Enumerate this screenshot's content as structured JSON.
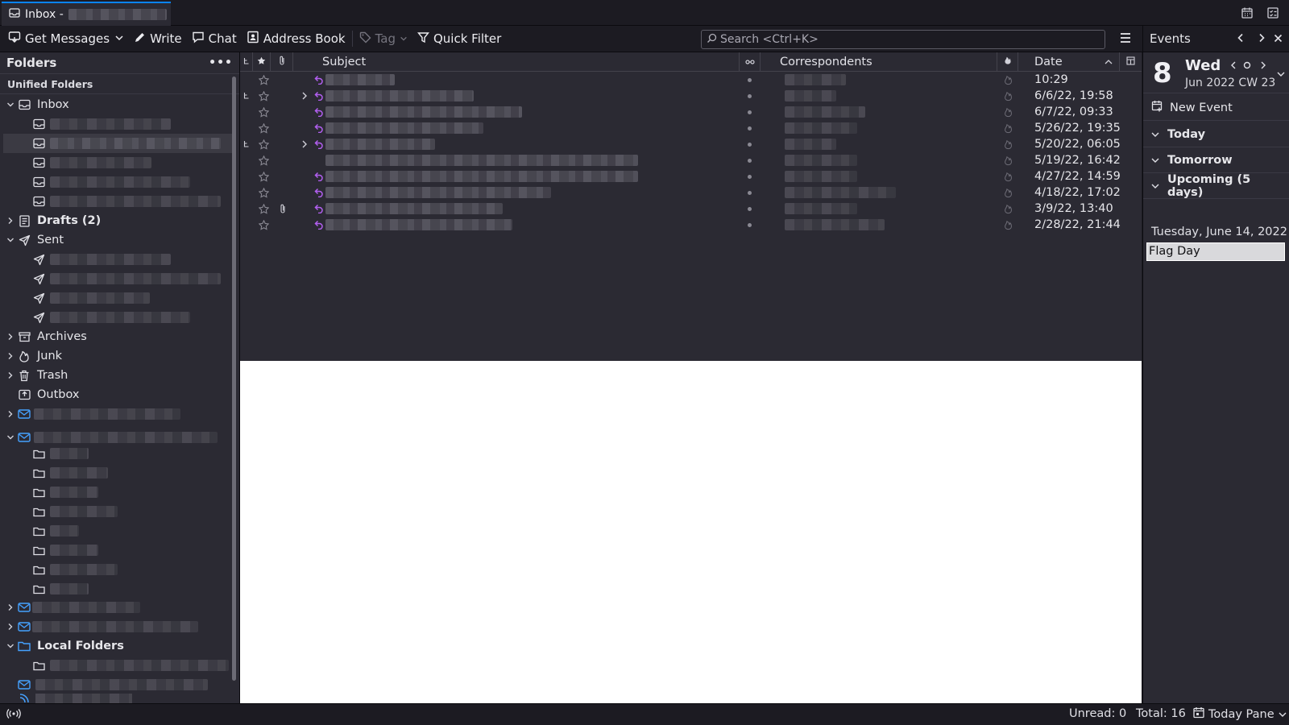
{
  "window": {
    "tab_title": "Inbox -"
  },
  "toolbar": {
    "get_messages": "Get Messages",
    "write": "Write",
    "chat": "Chat",
    "address_book": "Address Book",
    "tag": "Tag",
    "quick_filter": "Quick Filter",
    "search_placeholder": "Search <Ctrl+K>"
  },
  "folders": {
    "header": "Folders",
    "unified_header": "Unified Folders",
    "inbox": "Inbox",
    "drafts": "Drafts (2)",
    "sent": "Sent",
    "archives": "Archives",
    "junk": "Junk",
    "trash": "Trash",
    "outbox": "Outbox",
    "local_folders": "Local Folders"
  },
  "message_list": {
    "columns": {
      "subject": "Subject",
      "correspondents": "Correspondents",
      "date": "Date"
    },
    "rows": [
      {
        "date": "10:29",
        "replied": true,
        "thread": false,
        "expand": false,
        "attachment": false
      },
      {
        "date": "6/6/22, 19:58",
        "replied": true,
        "thread": true,
        "expand": true,
        "attachment": false
      },
      {
        "date": "6/7/22, 09:33",
        "replied": true,
        "thread": false,
        "expand": false,
        "attachment": false
      },
      {
        "date": "5/26/22, 19:35",
        "replied": true,
        "thread": false,
        "expand": false,
        "attachment": false
      },
      {
        "date": "5/20/22, 06:05",
        "replied": true,
        "thread": true,
        "expand": true,
        "attachment": false
      },
      {
        "date": "5/19/22, 16:42",
        "replied": false,
        "thread": false,
        "expand": false,
        "attachment": false
      },
      {
        "date": "4/27/22, 14:59",
        "replied": true,
        "thread": false,
        "expand": false,
        "attachment": false
      },
      {
        "date": "4/18/22, 17:02",
        "replied": true,
        "thread": false,
        "expand": false,
        "attachment": false
      },
      {
        "date": "3/9/22, 13:40",
        "replied": true,
        "thread": false,
        "expand": false,
        "attachment": true
      },
      {
        "date": "2/28/22, 21:44",
        "replied": true,
        "thread": false,
        "expand": false,
        "attachment": false
      }
    ]
  },
  "today_pane": {
    "title": "Events",
    "day_number": "8",
    "weekday": "Wed",
    "month_year": "Jun 2022",
    "week": "CW 23",
    "new_event": "New Event",
    "today": "Today",
    "tomorrow": "Tomorrow",
    "upcoming": "Upcoming (5 days)",
    "event_date": "Tuesday, June 14, 2022",
    "event_title": "Flag Day"
  },
  "status_bar": {
    "unread": "Unread: 0",
    "total": "Total: 16",
    "today_pane": "Today Pane"
  },
  "colors": {
    "accent": "#0a84ff",
    "replied_icon": "#b25ff0",
    "account_icon": "#45a1ff"
  }
}
